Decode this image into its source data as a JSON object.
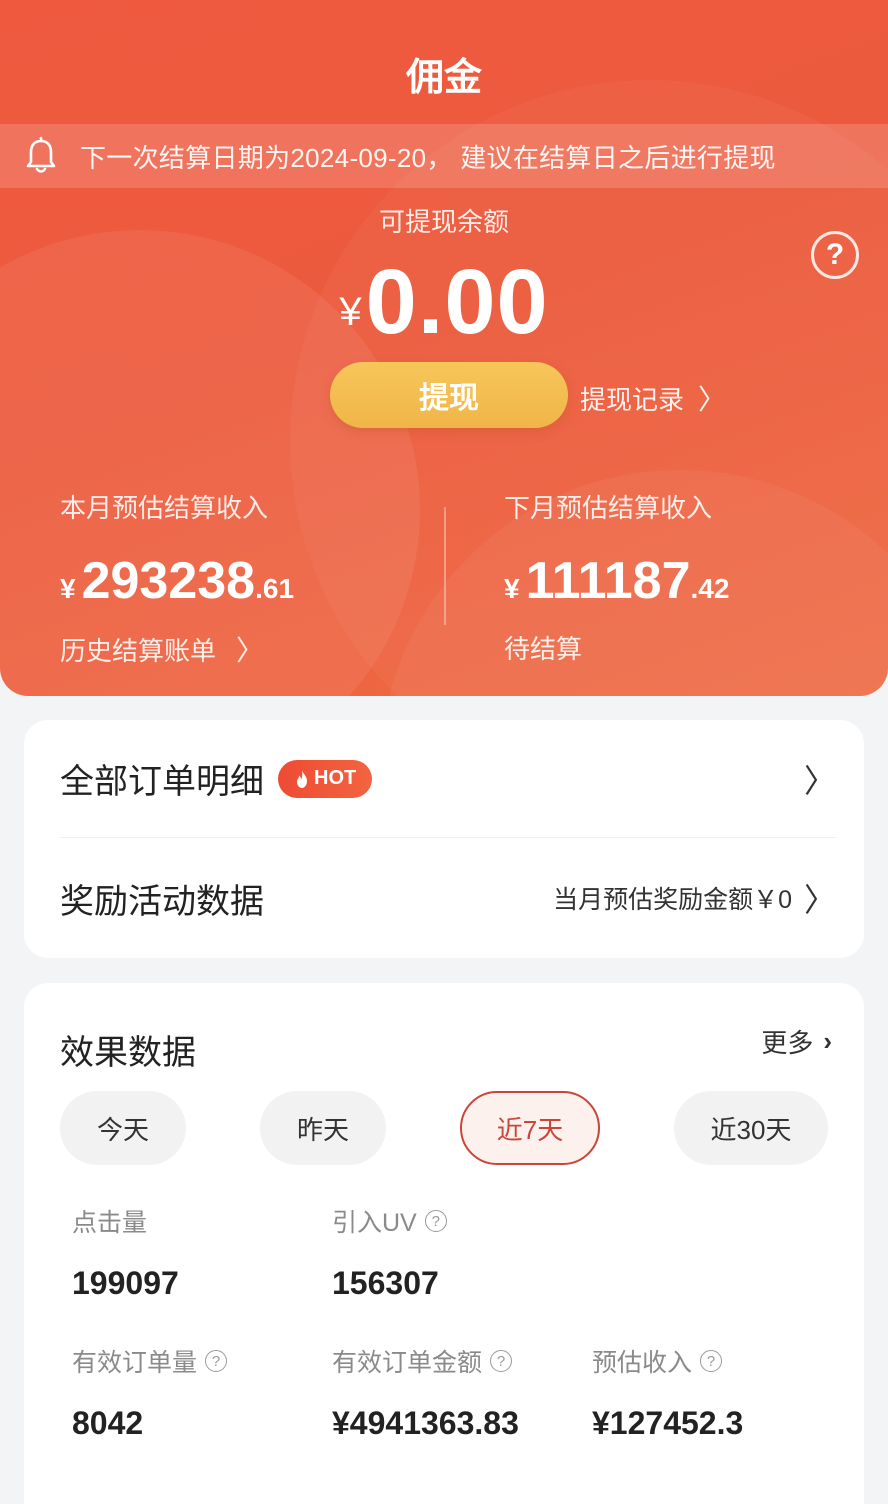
{
  "header": {
    "title": "佣金",
    "notice": "下一次结算日期为2024-09-20， 建议在结算日之后进行提现"
  },
  "balance": {
    "label": "可提现余额",
    "currency": "¥",
    "amount": "0.00",
    "withdraw_label": "提现",
    "record_label": "提现记录"
  },
  "estimates": {
    "this_month": {
      "label": "本月预估结算收入",
      "currency": "¥",
      "integer": "293238",
      "decimal": ".61",
      "link": "历史结算账单"
    },
    "next_month": {
      "label": "下月预估结算收入",
      "currency": "¥",
      "integer": "111187",
      "decimal": ".42",
      "status": "待结算"
    }
  },
  "menu": {
    "orders_label": "全部订单明细",
    "hot_badge": "HOT",
    "rewards_label": "奖励活动数据",
    "rewards_value": "当月预估奖励金额￥0"
  },
  "performance": {
    "title": "效果数据",
    "more": "更多",
    "tabs": [
      "今天",
      "昨天",
      "近7天",
      "近30天"
    ],
    "active_tab": "近7天",
    "metrics": [
      {
        "label": "点击量",
        "value": "199097",
        "help": false
      },
      {
        "label": "引入UV",
        "value": "156307",
        "help": true
      },
      {
        "label": "有效订单量",
        "value": "8042",
        "help": true
      },
      {
        "label": "有效订单金额",
        "value": "¥4941363.83",
        "help": true
      },
      {
        "label": "预估收入",
        "value": "¥127452.3",
        "help": true
      }
    ]
  },
  "colors": {
    "brand_red": "#ec5a3d",
    "withdraw_yellow": "#f4be52",
    "active_tab_red": "#c8463a"
  }
}
